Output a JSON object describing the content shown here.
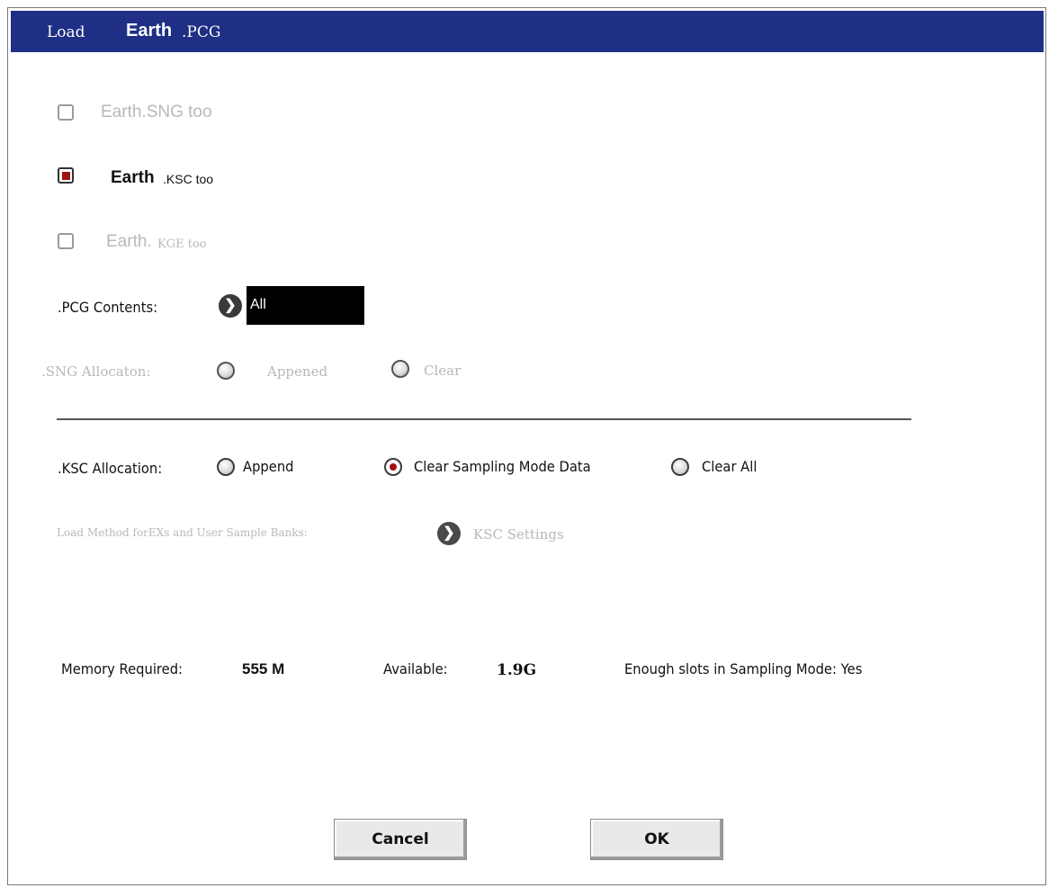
{
  "dialog": {
    "title_prefix": "Load",
    "title_name": "Earth",
    "title_ext": ".PCG"
  },
  "options": {
    "sng_too": {
      "label": "Earth.SNG too",
      "checked": false,
      "enabled": false
    },
    "ksc_too": {
      "name": "Earth",
      "suffix": ".KSC too",
      "checked": true,
      "enabled": true
    },
    "kge_too": {
      "name": "Earth.",
      "suffix": "KGE too",
      "checked": false,
      "enabled": false
    }
  },
  "pcg_contents": {
    "label": ".PCG Contents:",
    "value": "All"
  },
  "sng_allocation": {
    "label": ".SNG Allocaton:",
    "options": [
      "Appened",
      "Clear"
    ]
  },
  "ksc_allocation": {
    "label": ".KSC Allocation:",
    "options": [
      "Append",
      "Clear Sampling Mode Data",
      "Clear All"
    ],
    "selected": "Clear Sampling Mode Data"
  },
  "load_method": {
    "label": "Load Method forEXs and User Sample Banks:",
    "value": "KSC Settings"
  },
  "memory": {
    "required_label": "Memory Required:",
    "required_value": "555 M",
    "available_label": "Available:",
    "available_value": "1.9G",
    "slots_label": "Enough slots in Sampling Mode: Yes"
  },
  "buttons": {
    "cancel": "Cancel",
    "ok": "OK"
  },
  "colors": {
    "title_bar": "#1f2f85",
    "checked_fill": "#9b1313",
    "disabled_text": "#b8b8b8"
  }
}
